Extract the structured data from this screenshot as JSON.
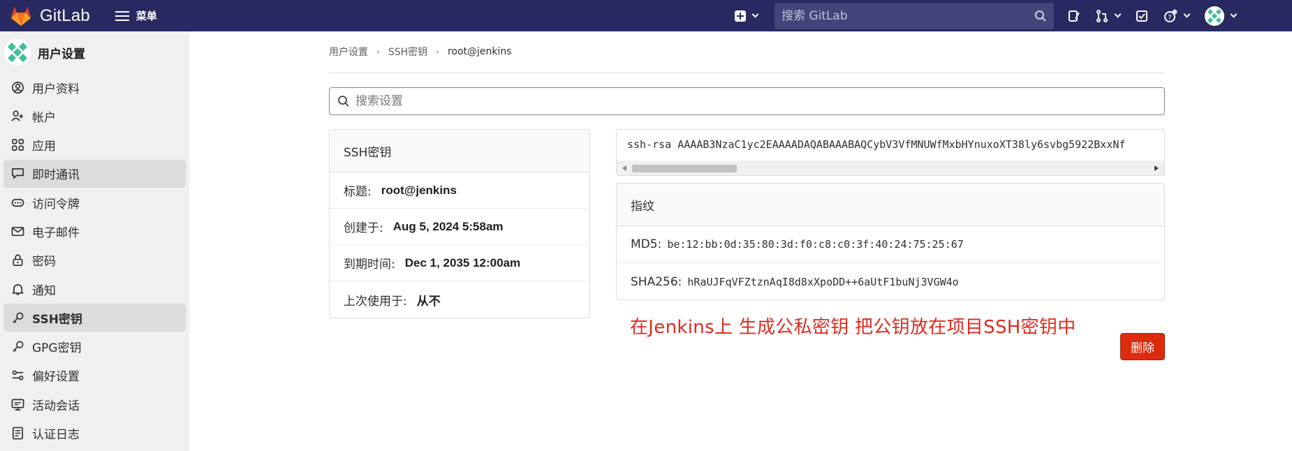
{
  "navbar": {
    "brand": "GitLab",
    "menu_label": "菜单",
    "search_placeholder": "搜索 GitLab"
  },
  "sidebar": {
    "title": "用户设置",
    "items": [
      {
        "label": "用户资料",
        "icon": "user-icon"
      },
      {
        "label": "帐户",
        "icon": "account-icon"
      },
      {
        "label": "应用",
        "icon": "applications-icon"
      },
      {
        "label": "即时通讯",
        "icon": "chat-icon"
      },
      {
        "label": "访问令牌",
        "icon": "token-icon"
      },
      {
        "label": "电子邮件",
        "icon": "mail-icon"
      },
      {
        "label": "密码",
        "icon": "lock-icon"
      },
      {
        "label": "通知",
        "icon": "bell-icon"
      },
      {
        "label": "SSH密钥",
        "icon": "key-icon"
      },
      {
        "label": "GPG密钥",
        "icon": "key-icon"
      },
      {
        "label": "偏好设置",
        "icon": "preferences-icon"
      },
      {
        "label": "活动会话",
        "icon": "monitor-icon"
      },
      {
        "label": "认证日志",
        "icon": "log-icon"
      }
    ]
  },
  "breadcrumb": [
    "用户设置",
    "SSH密钥",
    "root@jenkins"
  ],
  "settings_search": {
    "placeholder": "搜索设置"
  },
  "key_card": {
    "header": "SSH密钥",
    "rows": [
      {
        "label": "标题:",
        "value": "root@jenkins"
      },
      {
        "label": "创建于:",
        "value": "Aug 5, 2024 5:58am"
      },
      {
        "label": "到期时间:",
        "value": "Dec 1, 2035 12:00am"
      },
      {
        "label": "上次使用于:",
        "value": "从不"
      }
    ]
  },
  "public_key": "ssh-rsa AAAAB3NzaC1yc2EAAAADAQABAAABAQCybV3VfMNUWfMxbHYnuxoXT38ly6svbg5922BxxNf",
  "fingerprints": {
    "header": "指纹",
    "rows": [
      {
        "label": "MD5:",
        "value": "be:12:bb:0d:35:80:3d:f0:c8:c0:3f:40:24:75:25:67"
      },
      {
        "label": "SHA256:",
        "value": "hRaUJFqVFZtznAqI8d8xXpoDD++6aUtF1buNj3VGW4o"
      }
    ]
  },
  "annotation": "在Jenkins上 生成公私密钥  把公钥放在项目SSH密钥中",
  "delete_label": "删除",
  "colors": {
    "navbar": "#292961",
    "annotation": "#e02a1f",
    "danger": "#dd2b0e"
  }
}
